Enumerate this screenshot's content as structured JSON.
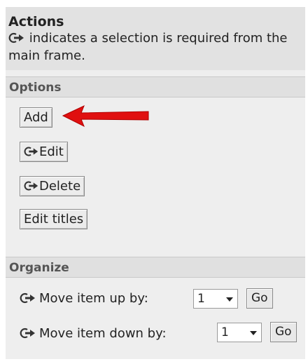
{
  "actions": {
    "title": "Actions",
    "description": "indicates a selection is required from the main frame.",
    "icon": "selection-required-icon"
  },
  "options": {
    "heading": "Options",
    "buttons": [
      {
        "label": "Add",
        "requires_selection": false
      },
      {
        "label": "Edit",
        "requires_selection": true
      },
      {
        "label": "Delete",
        "requires_selection": true
      },
      {
        "label": "Edit titles",
        "requires_selection": false
      }
    ]
  },
  "organize": {
    "heading": "Organize",
    "move_up": {
      "label": "Move item up by:",
      "value": "1",
      "go_label": "Go"
    },
    "move_down": {
      "label": "Move item down by:",
      "value": "1",
      "go_label": "Go"
    }
  },
  "annotation": {
    "icon": "red-arrow-icon",
    "color": "#e01010"
  }
}
